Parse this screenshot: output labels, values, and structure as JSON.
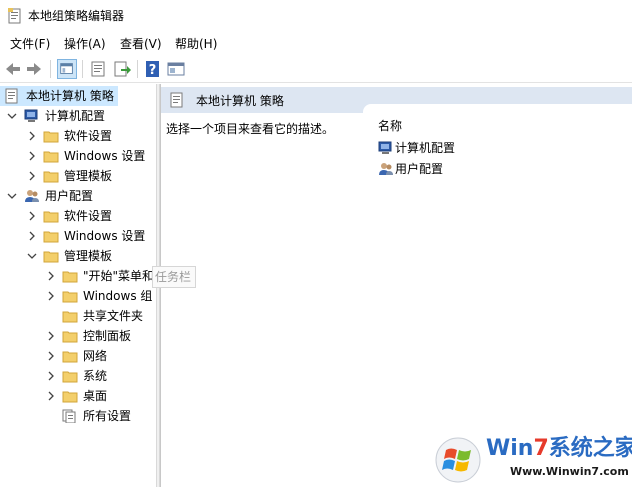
{
  "window": {
    "title": "本地组策略编辑器"
  },
  "menu": {
    "items": [
      "文件(F)",
      "操作(A)",
      "查看(V)",
      "帮助(H)"
    ]
  },
  "toolbar": {
    "buttons": [
      "back-icon",
      "forward-icon",
      "show-tree-icon",
      "properties-icon",
      "export-icon",
      "help-icon",
      "extended-view-icon"
    ]
  },
  "tree": {
    "root": "本地计算机 策略",
    "computer_config": "计算机配置",
    "cc_software": "软件设置",
    "cc_windows": "Windows 设置",
    "cc_admin": "管理模板",
    "user_config": "用户配置",
    "uc_software": "软件设置",
    "uc_windows": "Windows 设置",
    "uc_admin": "管理模板",
    "start_menu": "\"开始\"菜单和",
    "windows_components": "Windows 组",
    "shared_folders": "共享文件夹",
    "control_panel": "控制面板",
    "network": "网络",
    "system": "系统",
    "desktop": "桌面",
    "all_settings": "所有设置"
  },
  "tooltip": {
    "text": "任务栏"
  },
  "detail": {
    "title": "本地计算机 策略",
    "description": "选择一个项目来查看它的描述。",
    "column_name": "名称",
    "rows": [
      "计算机配置",
      "用户配置"
    ]
  },
  "watermark": {
    "brand_win": "Win",
    "brand_seven": "7",
    "brand_rest": "系统之家",
    "url": "Www.Winwin7.com"
  }
}
